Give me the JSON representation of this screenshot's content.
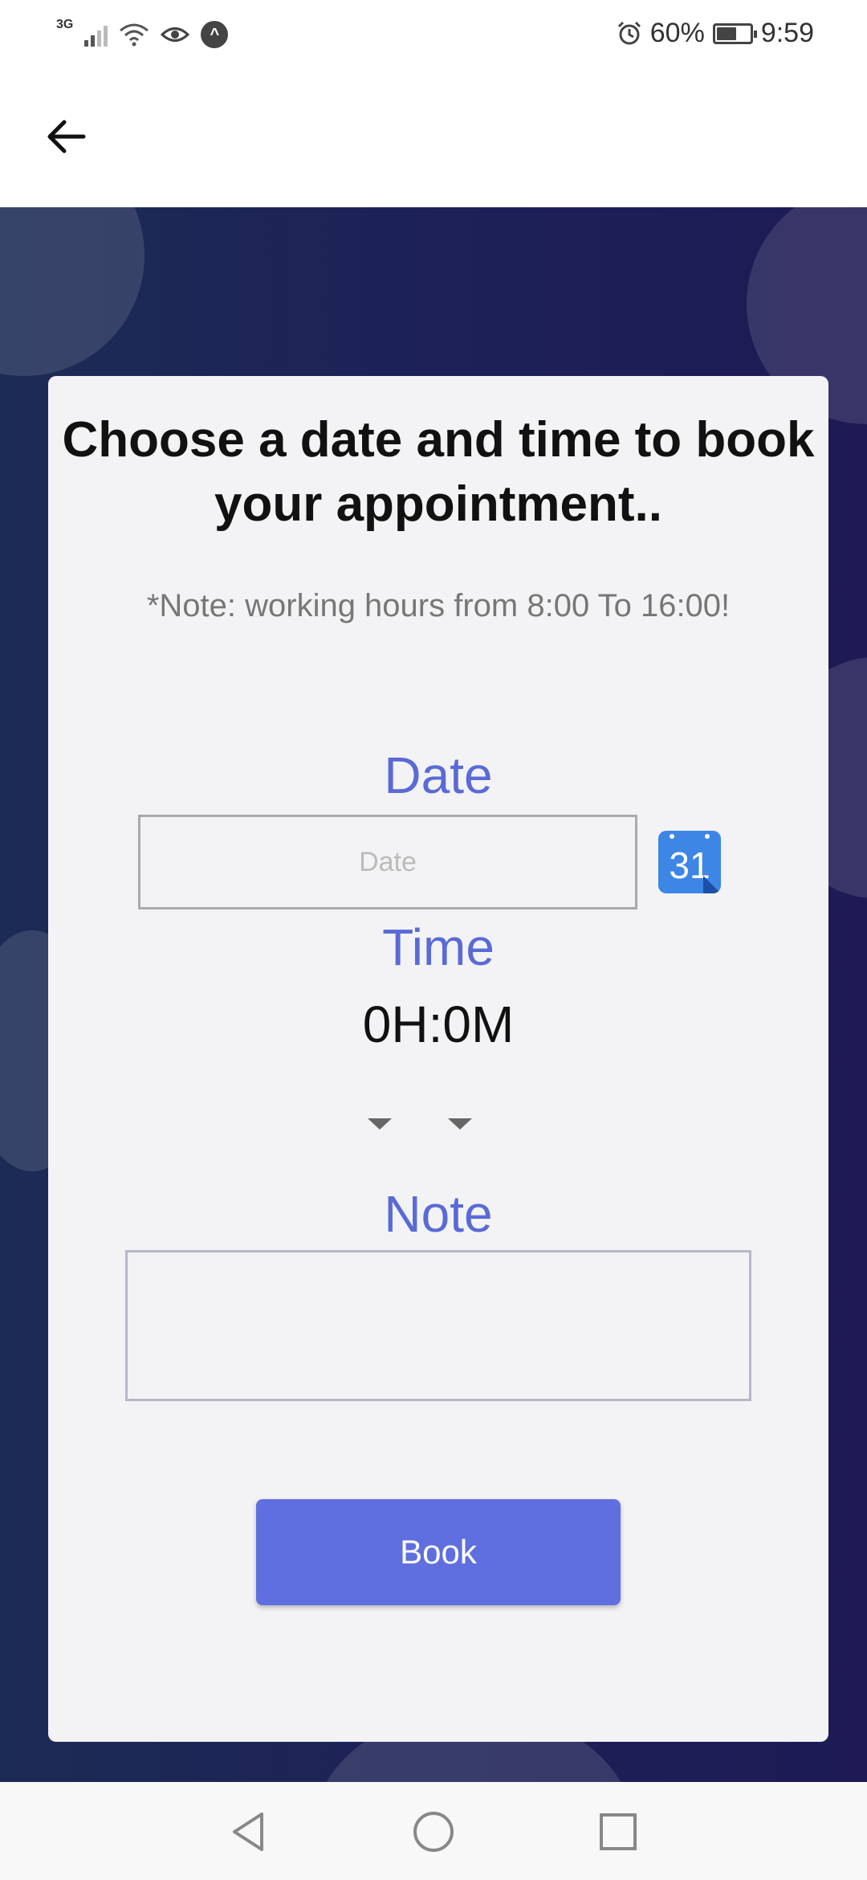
{
  "status_bar": {
    "network": "3G",
    "battery_percent": "60%",
    "battery_level": 0.6,
    "time": "9:59",
    "icons": [
      "signal-icon",
      "wifi-icon",
      "eye-icon",
      "app-a-icon",
      "alarm-icon",
      "battery-icon"
    ]
  },
  "app_bar": {
    "back_icon": "arrow-left-icon"
  },
  "card": {
    "title": "Choose a date and time to book your appointment..",
    "hint": "*Note: working hours from 8:00  To 16:00!",
    "date_label": "Date",
    "date_placeholder": "Date",
    "date_value": "",
    "calendar_icon_text": "31",
    "time_label": "Time",
    "time_value": "0H:0M",
    "note_label": "Note",
    "note_value": "",
    "book_label": "Book"
  },
  "nav_bar": {
    "icons": [
      "back-triangle-icon",
      "home-circle-icon",
      "recents-square-icon"
    ]
  },
  "colors": {
    "accent": "#5f6fe0",
    "label": "#5a6ad6",
    "background": "#1d2256",
    "card": "#f3f3f5"
  }
}
